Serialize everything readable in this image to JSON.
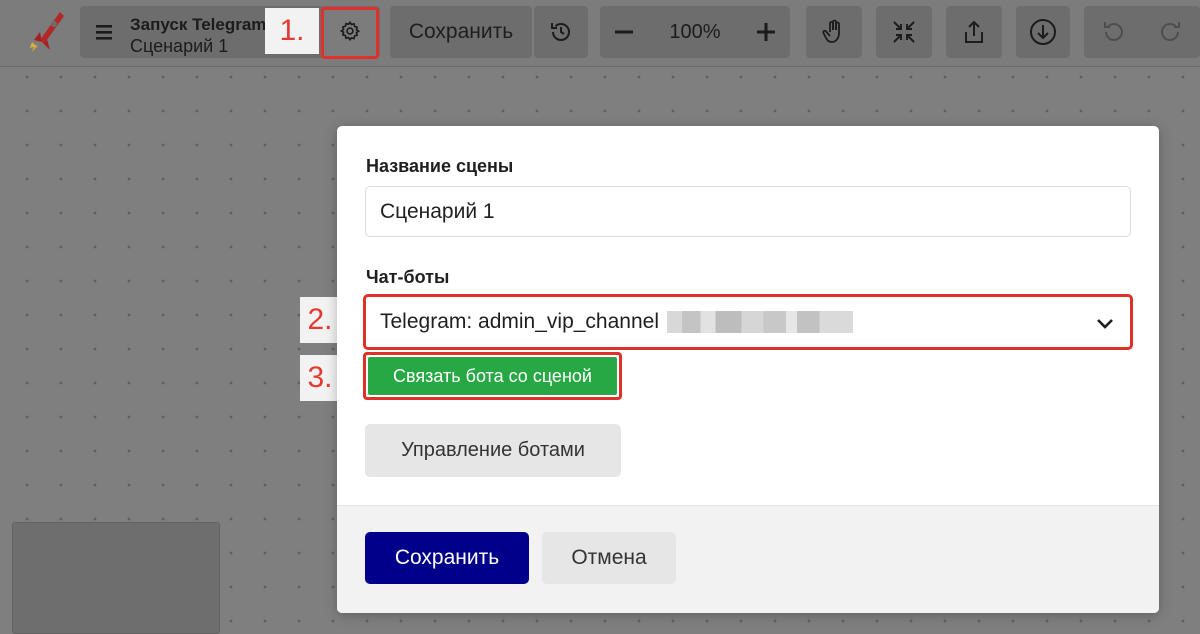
{
  "header": {
    "title": "Запуск Telegram-бота",
    "subtitle": "Сценарий 1",
    "save_label": "Сохранить",
    "zoom": "100%",
    "zoom_out_label": "−",
    "zoom_in_label": "+"
  },
  "annotations": {
    "step1": "1.",
    "step2": "2.",
    "step3": "3."
  },
  "modal": {
    "scene_name_label": "Название сцены",
    "scene_name_value": "Сценарий 1",
    "chatbots_label": "Чат-боты",
    "selected_bot": "Telegram: admin_vip_channel",
    "link_bot_button": "Связать бота со сценой",
    "manage_bots_button": "Управление ботами",
    "save_button": "Сохранить",
    "cancel_button": "Отмена"
  },
  "colors": {
    "accent_red": "#e0302a",
    "link_green": "#28a745",
    "save_navy": "#00008b"
  },
  "icons": [
    "rocket-logo-icon",
    "menu-icon",
    "gear-icon",
    "history-icon",
    "minus-icon",
    "plus-icon",
    "hand-icon",
    "fit-icon",
    "share-icon",
    "download-icon",
    "undo-icon",
    "redo-icon",
    "chevron-down-icon"
  ]
}
